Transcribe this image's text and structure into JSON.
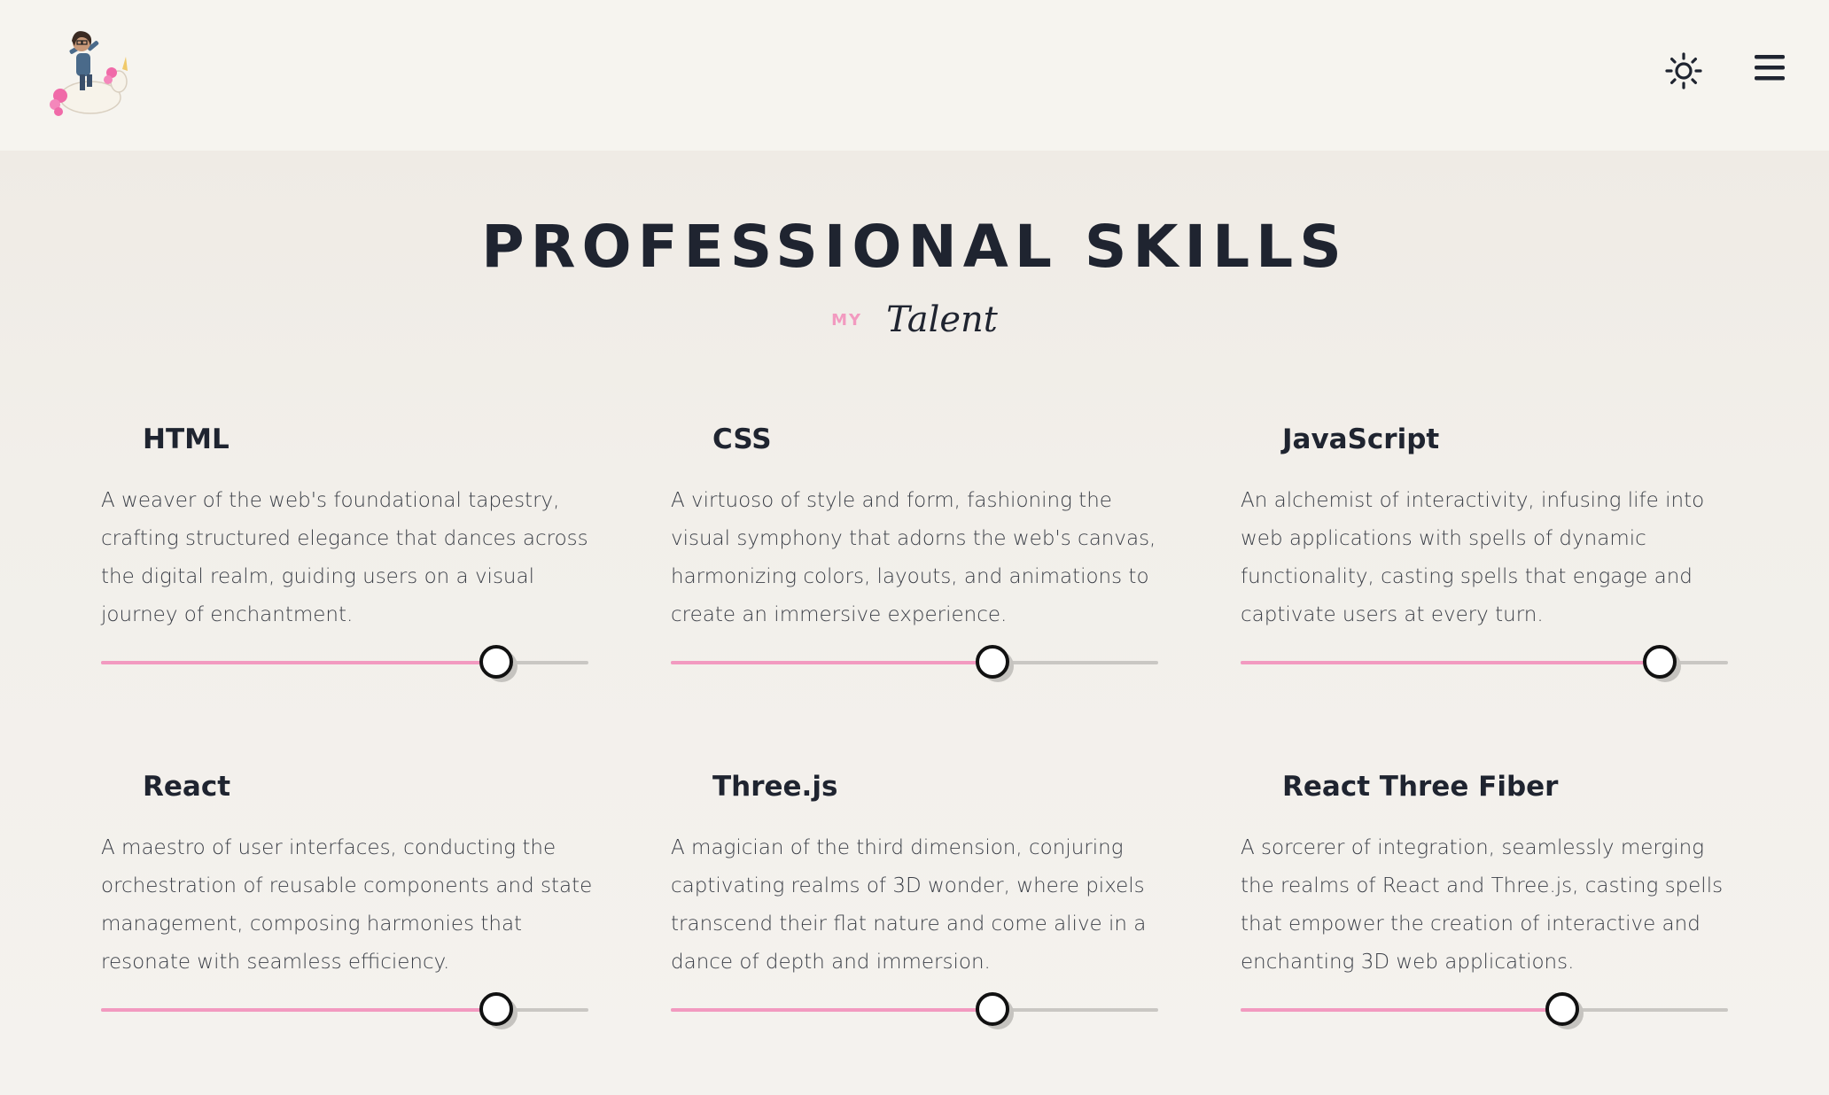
{
  "header": {
    "logo_icon": "bitmoji-unicorn-avatar-icon",
    "theme_toggle_icon": "sun-icon",
    "menu_icon": "hamburger-menu-icon"
  },
  "section": {
    "title": "PROFESSIONAL SKILLS",
    "subtitle_small": "MY",
    "subtitle_script": "Talent"
  },
  "colors": {
    "accent_pink": "#f29ac0",
    "text_dark": "#1f2430",
    "track_gray": "#c9c7c3"
  },
  "skills": [
    {
      "name": "HTML",
      "description": "A weaver of the web's foundational tapestry, crafting structured elegance that dances across the digital realm, guiding users on a visual journey of enchantment.",
      "level_percent": 81
    },
    {
      "name": "CSS",
      "description": "A virtuoso of style and form, fashioning the visual symphony that adorns the web's canvas, harmonizing colors, layouts, and animations to create an immersive experience.",
      "level_percent": 66
    },
    {
      "name": "JavaScript",
      "description": "An alchemist of interactivity, infusing life into web applications with spells of dynamic functionality, casting spells that engage and captivate users at every turn.",
      "level_percent": 86
    },
    {
      "name": "React",
      "description": "A maestro of user interfaces, conducting the orchestration of reusable components and state management, composing harmonies that resonate with seamless efficiency.",
      "level_percent": 81
    },
    {
      "name": "Three.js",
      "description": "A magician of the third dimension, conjuring captivating realms of 3D wonder, where pixels transcend their flat nature and come alive in a dance of depth and immersion.",
      "level_percent": 66
    },
    {
      "name": "React Three Fiber",
      "description": "A sorcerer of integration, seamlessly merging the realms of React and Three.js, casting spells that empower the creation of interactive and enchanting 3D web applications.",
      "level_percent": 66
    }
  ]
}
